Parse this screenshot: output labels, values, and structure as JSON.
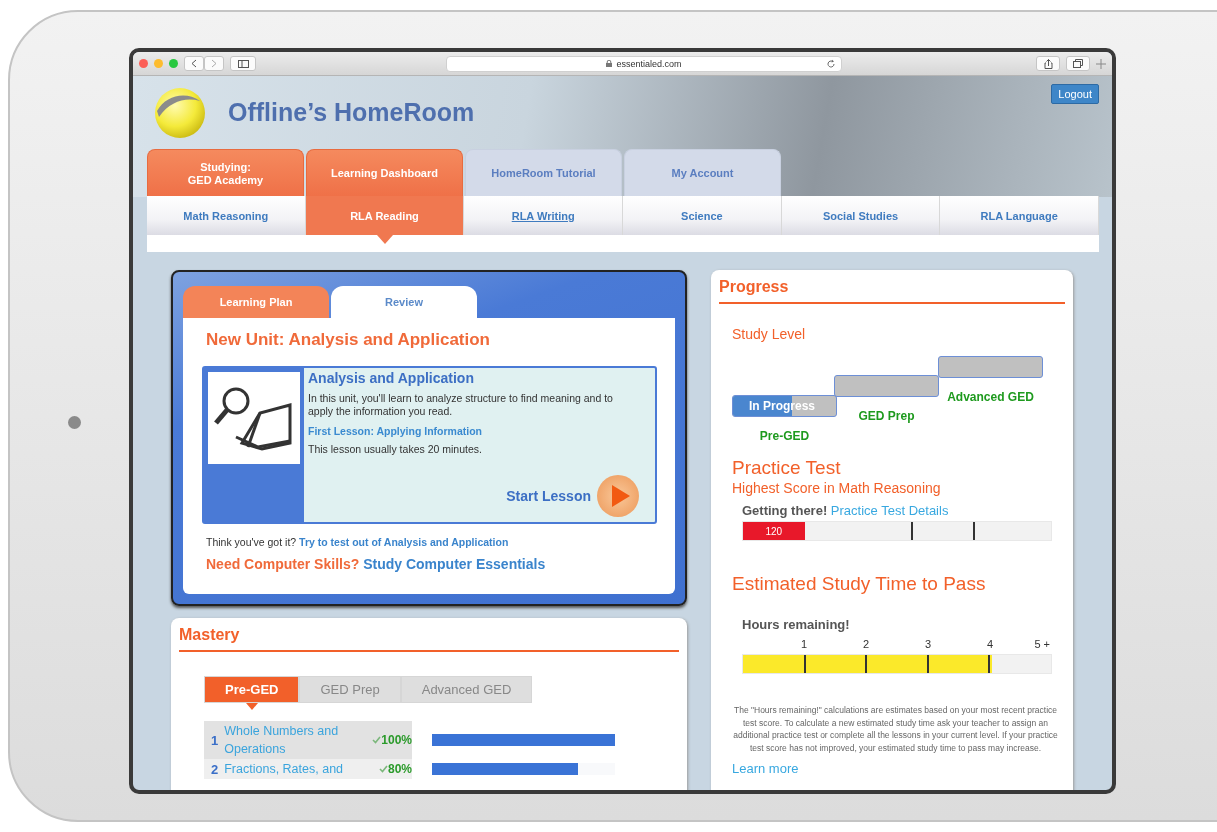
{
  "browser": {
    "url": "essentialed.com"
  },
  "header": {
    "title": "Offline’s HomeRoom",
    "logout": "Logout"
  },
  "main_tabs": [
    {
      "label": "Studying:\nGED Academy",
      "selected": true
    },
    {
      "label": "Learning Dashboard",
      "selected": true
    },
    {
      "label": "HomeRoom Tutorial",
      "selected": false
    },
    {
      "label": "My Account",
      "selected": false
    }
  ],
  "subject_tabs": [
    {
      "label": "Math Reasoning",
      "selected": false,
      "underlined": false
    },
    {
      "label": "RLA Reading",
      "selected": true,
      "underlined": false
    },
    {
      "label": "RLA Writing",
      "selected": false,
      "underlined": true
    },
    {
      "label": "Science",
      "selected": false,
      "underlined": false
    },
    {
      "label": "Social Studies",
      "selected": false,
      "underlined": false
    },
    {
      "label": "RLA Language",
      "selected": false,
      "underlined": false
    }
  ],
  "lesson_card": {
    "tabs": [
      {
        "label": "Learning Plan",
        "selected": true
      },
      {
        "label": "Review",
        "selected": false
      }
    ],
    "unit_title": "New Unit: Analysis and Application",
    "lesson": {
      "title": "Analysis and Application",
      "description": "In this unit, you'll learn to analyze structure to find meaning and to apply the information you read.",
      "first_lesson": "First Lesson: Applying Information",
      "duration": "This lesson usually takes 20 minutes.",
      "start": "Start Lesson"
    },
    "test_out": {
      "prompt": "Think you've got it?",
      "link": "Try to test out of Analysis and Application"
    },
    "computer_skills": {
      "prompt": "Need Computer Skills?",
      "link": "Study Computer Essentials"
    }
  },
  "mastery": {
    "title": "Mastery",
    "level_tabs": [
      {
        "label": "Pre-GED",
        "selected": true
      },
      {
        "label": "GED Prep",
        "selected": false
      },
      {
        "label": "Advanced GED",
        "selected": false
      }
    ],
    "topics": [
      {
        "number": "1",
        "name": "Whole Numbers and Operations",
        "score": "100%",
        "level": 1
      },
      {
        "number": "2",
        "name": "Fractions, Rates, and",
        "score": "80%",
        "level": 0.8
      }
    ]
  },
  "progress": {
    "title": "Progress",
    "study_level": {
      "title": "Study Level",
      "steps": [
        {
          "label": "Pre-GED",
          "status": "In Progress",
          "level": 0.57
        },
        {
          "label": "GED Prep",
          "level": 0
        },
        {
          "label": "Advanced GED",
          "level": 0
        }
      ]
    },
    "practice_test": {
      "title": "Practice Test",
      "subtitle": "Highest Score in Math Reasoning",
      "status": "Getting there!",
      "link": "Practice Test Details",
      "score": "120",
      "level": 0.2
    },
    "study_time": {
      "title": "Estimated Study Time to Pass",
      "label": "Hours remaining!",
      "ticks": [
        "1",
        "2",
        "3",
        "4",
        "5 +"
      ],
      "level": 0.81,
      "note": "The \"Hours remaining!\" calculations are estimates based on your most recent practice test score. To calculate a new estimated study time ask your teacher to assign an additional practice test or complete all the lessons in your current level. If your practice test score has not improved, your estimated study time to pass may increase.",
      "learn_more": "Learn more"
    }
  }
}
